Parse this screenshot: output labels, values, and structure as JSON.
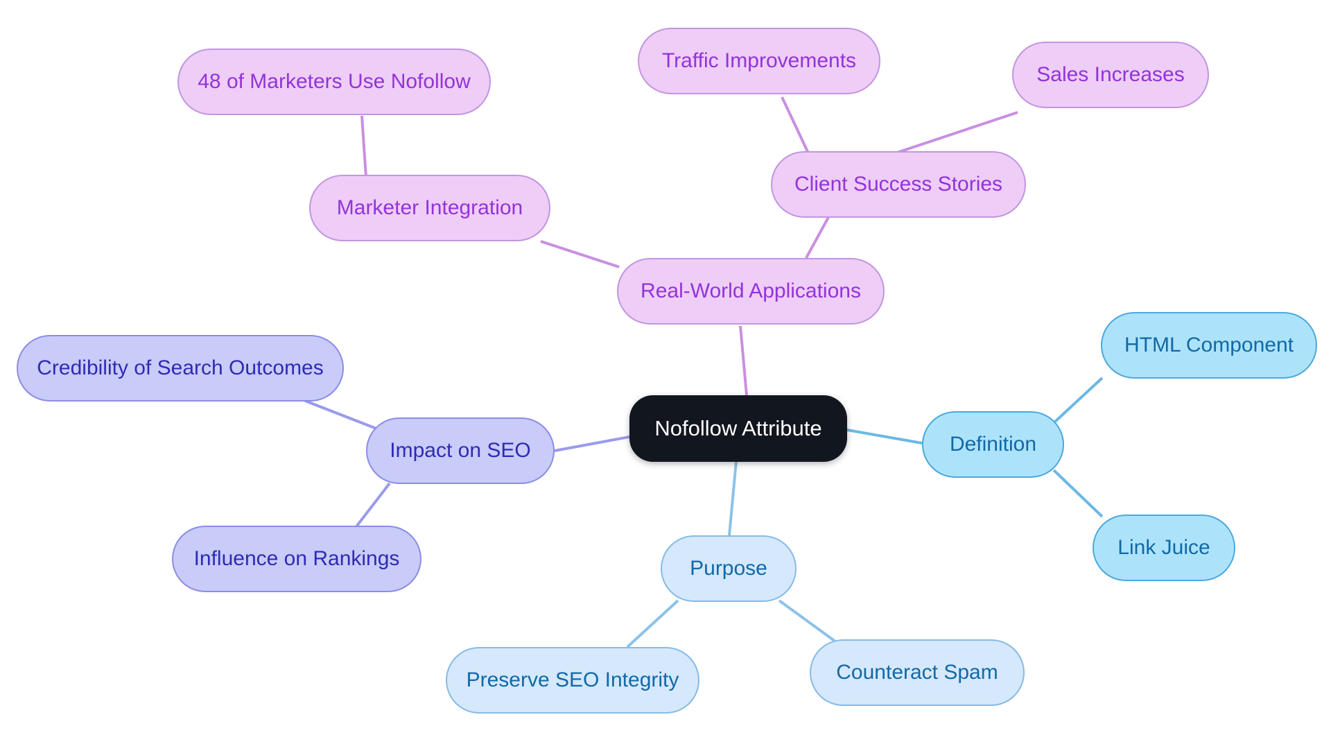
{
  "diagram": {
    "type": "mindmap",
    "title": "Nofollow Attribute",
    "background_color": "#ffffff"
  },
  "root": {
    "id": "root",
    "label": "Nofollow Attribute",
    "fill": "#12161f",
    "text_color": "#ffffff"
  },
  "branches": [
    {
      "id": "definition",
      "label": "Definition",
      "fill": "#ade3fa",
      "border": "#4aa8de",
      "text_color": "#1069a8",
      "edge_color": "#6cb8e4",
      "children": [
        {
          "id": "html-component",
          "label": "HTML Component"
        },
        {
          "id": "link-juice",
          "label": "Link Juice"
        }
      ]
    },
    {
      "id": "purpose",
      "label": "Purpose",
      "fill": "#d6e8fb",
      "border": "#86bbe6",
      "text_color": "#1069a8",
      "edge_color": "#8cc2e8",
      "children": [
        {
          "id": "preserve-seo-integrity",
          "label": "Preserve SEO Integrity"
        },
        {
          "id": "counteract-spam",
          "label": "Counteract Spam"
        }
      ]
    },
    {
      "id": "impact-on-seo",
      "label": "Impact on SEO",
      "fill": "#c9cbf8",
      "border": "#8b8ce6",
      "text_color": "#2d2bb5",
      "edge_color": "#9a9bea",
      "children": [
        {
          "id": "credibility-of-search-outcomes",
          "label": "Credibility of Search Outcomes"
        },
        {
          "id": "influence-on-rankings",
          "label": "Influence on Rankings"
        }
      ]
    },
    {
      "id": "real-world-applications",
      "label": "Real-World Applications",
      "fill": "#eecdf7",
      "border": "#c295e0",
      "text_color": "#9333d9",
      "edge_color": "#c98fe0",
      "children": [
        {
          "id": "marketer-integration",
          "label": "Marketer Integration"
        },
        {
          "id": "client-success-stories",
          "label": "Client Success Stories"
        }
      ]
    },
    {
      "id": "marketer-integration-children",
      "children": [
        {
          "id": "48-of-marketers-use-nofollow",
          "label": "48 of Marketers Use Nofollow"
        }
      ]
    },
    {
      "id": "client-success-stories-children",
      "children": [
        {
          "id": "traffic-improvements",
          "label": "Traffic Improvements"
        },
        {
          "id": "sales-increases",
          "label": "Sales Increases"
        }
      ]
    }
  ]
}
